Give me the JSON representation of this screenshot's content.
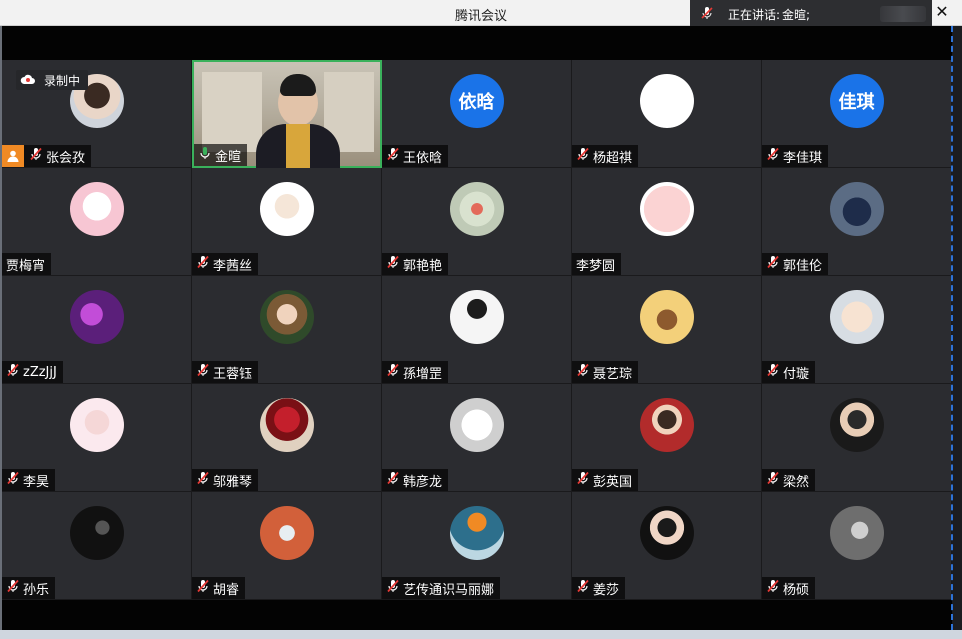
{
  "window": {
    "title": "腾讯会议",
    "close_glyph": "✕"
  },
  "speaker_bar": {
    "label": "正在讲话:",
    "name": "金暄;"
  },
  "recording": {
    "label": "录制中"
  },
  "colors": {
    "active_border": "#3ab15b",
    "host_badge": "#f08a24",
    "text_avatar_bg": "#1a73e8",
    "mic_red": "#e53935"
  },
  "participants": [
    {
      "name": "张会孜",
      "avatar": "photo-woman",
      "mic": "off",
      "host": true,
      "recording": true
    },
    {
      "name": "金暄",
      "avatar": "video",
      "mic": "on",
      "active": true
    },
    {
      "name": "王依晗",
      "avatar": "text",
      "avatar_text": "依晗",
      "mic": "off"
    },
    {
      "name": "杨超祺",
      "avatar": "blank-white",
      "mic": "off"
    },
    {
      "name": "李佳琪",
      "avatar": "text",
      "avatar_text": "佳琪",
      "mic": "off"
    },
    {
      "name": "贾梅宵",
      "avatar": "cartoon-pink",
      "mic": "none"
    },
    {
      "name": "李茜丝",
      "avatar": "cartoon-girl",
      "mic": "off"
    },
    {
      "name": "郭艳艳",
      "avatar": "flowers",
      "mic": "off"
    },
    {
      "name": "李梦圆",
      "avatar": "cartoon-pig",
      "mic": "none"
    },
    {
      "name": "郭佳伦",
      "avatar": "car",
      "mic": "off"
    },
    {
      "name": "zZzJjJ",
      "avatar": "purple-art",
      "mic": "off"
    },
    {
      "name": "王蓉钰",
      "avatar": "photo-girl",
      "mic": "off"
    },
    {
      "name": "孫增罡",
      "avatar": "photo-man-white",
      "mic": "off"
    },
    {
      "name": "聂艺琮",
      "avatar": "cartoon-umbrella",
      "mic": "off"
    },
    {
      "name": "付璇",
      "avatar": "cartoon-boy",
      "mic": "off"
    },
    {
      "name": "李昊",
      "avatar": "cartoon-lady",
      "mic": "off"
    },
    {
      "name": "邬雅琴",
      "avatar": "red-flowers",
      "mic": "off"
    },
    {
      "name": "韩彦龙",
      "avatar": "sketch",
      "mic": "off"
    },
    {
      "name": "彭英国",
      "avatar": "photo-man-red",
      "mic": "off"
    },
    {
      "name": "梁然",
      "avatar": "photo-man-glasses",
      "mic": "off"
    },
    {
      "name": "孙乐",
      "avatar": "dark-silhouette",
      "mic": "off"
    },
    {
      "name": "胡睿",
      "avatar": "orange-art",
      "mic": "off"
    },
    {
      "name": "艺传通识马丽娜",
      "avatar": "sea-art",
      "mic": "off"
    },
    {
      "name": "姜莎",
      "avatar": "photo-woman-dark",
      "mic": "off"
    },
    {
      "name": "杨硕",
      "avatar": "photo-bw",
      "mic": "off"
    }
  ]
}
